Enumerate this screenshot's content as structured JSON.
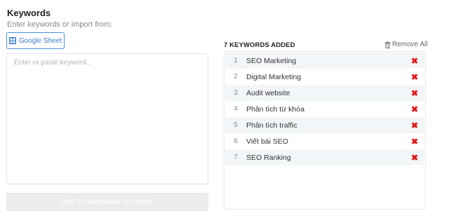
{
  "header": {
    "title": "Keywords",
    "subtitle": "Enter keywords or import from:"
  },
  "import": {
    "google_sheet_label": "Google Sheet",
    "google_sheet_icon": "google-sheets-icon"
  },
  "input": {
    "placeholder": "Enter or paste keyword...",
    "value": ""
  },
  "add_button": {
    "label": "Add 0/0 Keywords To Project"
  },
  "added": {
    "header": "7 KEYWORDS ADDED",
    "remove_all_label": "Remove All",
    "items": [
      {
        "index": "1",
        "text": "SEO Marketing"
      },
      {
        "index": "2",
        "text": "Digital Marketing"
      },
      {
        "index": "3",
        "text": "Audit website"
      },
      {
        "index": "4",
        "text": "Phân tích từ khóa"
      },
      {
        "index": "5",
        "text": "Phân tích traffic"
      },
      {
        "index": "6",
        "text": "Viết bài SEO"
      },
      {
        "index": "7",
        "text": "SEO Ranking"
      }
    ],
    "delete_glyph": "✖"
  },
  "colors": {
    "accent": "#4a90d9",
    "delete": "#e01818",
    "row_alt": "#f3f6f8"
  }
}
